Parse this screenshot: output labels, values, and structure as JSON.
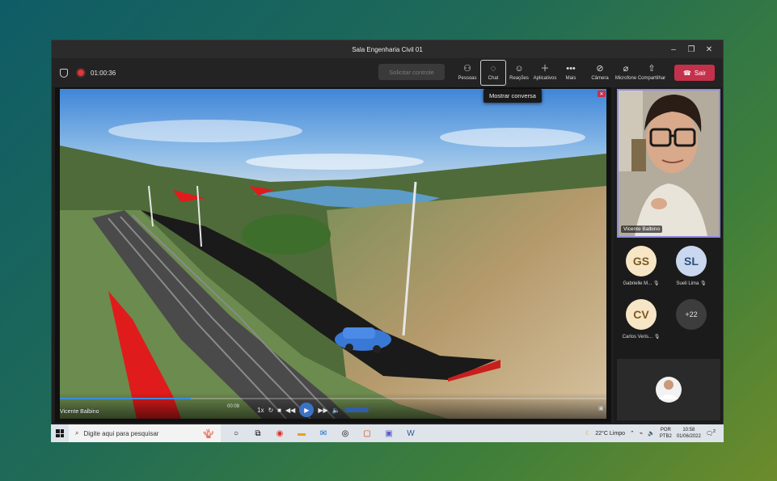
{
  "window": {
    "title": "Sala Engenharia Civil 01",
    "controls": {
      "minimize": "–",
      "maximize": "❐",
      "close": "✕"
    }
  },
  "meeting": {
    "timer": "01:00:36",
    "request_control": "Solicitar controle",
    "toolbar": [
      {
        "label": "Pessoas",
        "icon": "people-icon"
      },
      {
        "label": "Chat",
        "icon": "chat-icon"
      },
      {
        "label": "Reações",
        "icon": "reactions-icon"
      },
      {
        "label": "Aplicativos",
        "icon": "apps-icon"
      },
      {
        "label": "Mais",
        "icon": "more-icon"
      }
    ],
    "media": [
      {
        "label": "Câmera",
        "icon": "camera-off-icon"
      },
      {
        "label": "Microfone",
        "icon": "mic-off-icon"
      },
      {
        "label": "Compartilhar",
        "icon": "share-icon"
      }
    ],
    "leave_label": "Sair",
    "tooltip": "Mostrar conversa"
  },
  "presentation": {
    "presenter": "Vicente Balbino",
    "time": "00:08",
    "progress_fraction": 0.24
  },
  "participants": {
    "camera_name": "Vicente Balbino",
    "avatars": [
      {
        "initials": "GS",
        "name": "Gabrielle M..."
      },
      {
        "initials": "SL",
        "name": "Sueli Lima"
      },
      {
        "initials": "CV",
        "name": "Carlos Veris..."
      },
      {
        "initials": "+22",
        "name": ""
      }
    ]
  },
  "taskbar": {
    "search_placeholder": "Digite aqui para pesquisar",
    "weather": "22°C Limpo",
    "lang_top": "POR",
    "lang_bottom": "PTB2",
    "time": "10:58",
    "date": "01/06/2022",
    "notifications": "2"
  },
  "colors": {
    "leave": "#c4314b",
    "accent": "#8d8be0",
    "avatar_gs": "#f7e6c6",
    "avatar_sl": "#c9d8ee",
    "avatar_cv": "#f7e6c6",
    "avatar_more": "#3d3d3d"
  }
}
